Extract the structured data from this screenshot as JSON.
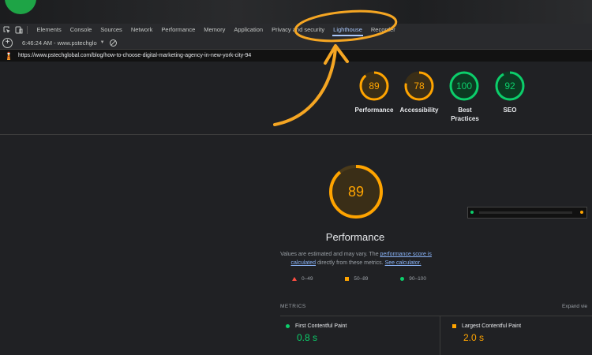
{
  "devtools": {
    "tabs": [
      "Elements",
      "Console",
      "Sources",
      "Network",
      "Performance",
      "Memory",
      "Application",
      "Privacy and security",
      "Lighthouse",
      "Recorder"
    ],
    "active_tab": "Lighthouse",
    "report_selector": "6:46:24 AM - www.pstechglo",
    "url": "https://www.pstechglobal.com/blog/how-to-choose-digital-marketing-agency-in-new-york-city-94"
  },
  "scores": [
    {
      "label": "Performance",
      "value": "89",
      "color": "#ffa400",
      "fraction": 0.89
    },
    {
      "label": "Accessibility",
      "value": "78",
      "color": "#ffa400",
      "fraction": 0.78
    },
    {
      "label": "Best Practices",
      "value": "100",
      "color": "#0cce6b",
      "fraction": 1.0
    },
    {
      "label": "SEO",
      "value": "92",
      "color": "#0cce6b",
      "fraction": 0.92
    }
  ],
  "performance": {
    "score": "89",
    "fraction": 0.89,
    "title": "Performance",
    "note_prefix": "Values are estimated and may vary. The",
    "note_link1": "performance score is calculated",
    "note_middle": "directly from these metrics.",
    "note_link2": "See calculator.",
    "legend": [
      "0–49",
      "50–89",
      "90–100"
    ]
  },
  "metrics": {
    "header": "METRICS",
    "expand": "Expand vie",
    "items": [
      {
        "name": "First Contentful Paint",
        "value": "0.8 s",
        "color": "#0cce6b"
      },
      {
        "name": "Largest Contentful Paint",
        "value": "2.0 s",
        "color": "#ffa400"
      }
    ]
  },
  "colors": {
    "good": "#0cce6b",
    "average": "#ffa400",
    "fail": "#ff4e42",
    "annotation": "#f5a623"
  }
}
